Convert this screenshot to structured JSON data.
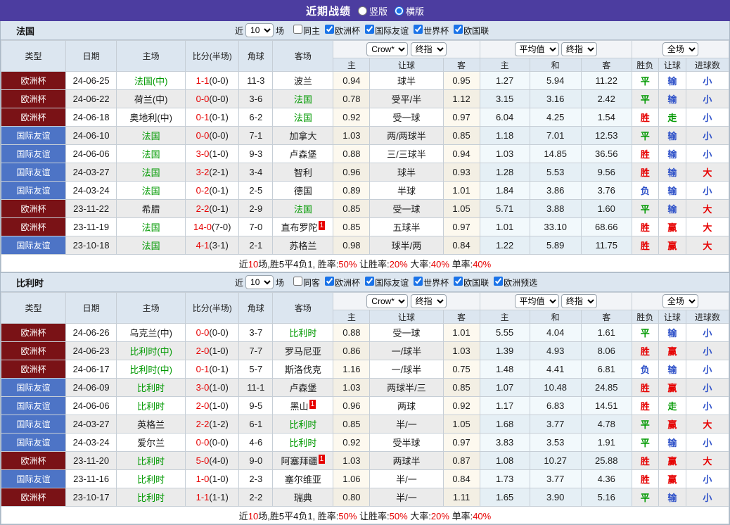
{
  "colors": {
    "titlebar_bg": "#4c3da0",
    "header_bg": "#dce6f0",
    "cup_badge": "#7a1216",
    "friendly_badge": "#4d74c6",
    "focus_team": "#009900",
    "score_red": "#e60000",
    "lose_blue": "#2d50c8",
    "stripe_bg": "#ebebeb"
  },
  "titlebar": {
    "title": "近期战绩",
    "options": [
      {
        "label": "竖版",
        "checked": false
      },
      {
        "label": "横版",
        "checked": true
      }
    ]
  },
  "table_header": {
    "static": [
      "类型",
      "日期",
      "主场",
      "比分(半场)",
      "角球",
      "客场"
    ],
    "group1": {
      "selects": [
        "Crow*",
        "终指"
      ],
      "cols": [
        "主",
        "让球",
        "客"
      ]
    },
    "group2": {
      "selects": [
        "平均值",
        "终指"
      ],
      "cols": [
        "主",
        "和",
        "客"
      ]
    },
    "group3": {
      "selects": [
        "全场"
      ],
      "cols": [
        "胜负",
        "让球",
        "进球数"
      ]
    }
  },
  "sections": [
    {
      "team": "法国",
      "filter": {
        "near_label": "近",
        "count": "10",
        "matches_label": "场",
        "same_label": "同主",
        "same_checked": false,
        "leagues": [
          "欧洲杯",
          "国际友谊",
          "世界杯",
          "欧国联"
        ]
      },
      "rows": [
        {
          "league": "欧洲杯",
          "league_type": "cup",
          "date": "24-06-25",
          "home": "法国(中)",
          "home_focus": true,
          "score": "1-1",
          "half": "(0-0)",
          "corners": "11-3",
          "away": "波兰",
          "away_focus": false,
          "away_sup": "",
          "odds_home": "0.94",
          "handicap": "球半",
          "odds_away": "0.95",
          "avg_home": "1.27",
          "avg_draw": "5.94",
          "avg_away": "11.22",
          "res_wdl": "平",
          "res_wdl_c": "green",
          "res_hc": "输",
          "res_hc_c": "blue",
          "res_goal": "小",
          "res_goal_c": "blue"
        },
        {
          "league": "欧洲杯",
          "league_type": "cup",
          "date": "24-06-22",
          "home": "荷兰(中)",
          "home_focus": false,
          "score": "0-0",
          "half": "(0-0)",
          "corners": "3-6",
          "away": "法国",
          "away_focus": true,
          "away_sup": "",
          "odds_home": "0.78",
          "handicap": "受平/半",
          "odds_away": "1.12",
          "avg_home": "3.15",
          "avg_draw": "3.16",
          "avg_away": "2.42",
          "res_wdl": "平",
          "res_wdl_c": "green",
          "res_hc": "输",
          "res_hc_c": "blue",
          "res_goal": "小",
          "res_goal_c": "blue"
        },
        {
          "league": "欧洲杯",
          "league_type": "cup",
          "date": "24-06-18",
          "home": "奥地利(中)",
          "home_focus": false,
          "score": "0-1",
          "half": "(0-1)",
          "corners": "6-2",
          "away": "法国",
          "away_focus": true,
          "away_sup": "",
          "odds_home": "0.92",
          "handicap": "受一球",
          "odds_away": "0.97",
          "avg_home": "6.04",
          "avg_draw": "4.25",
          "avg_away": "1.54",
          "res_wdl": "胜",
          "res_wdl_c": "red",
          "res_hc": "走",
          "res_hc_c": "green",
          "res_goal": "小",
          "res_goal_c": "blue"
        },
        {
          "league": "国际友谊",
          "league_type": "friendly",
          "date": "24-06-10",
          "home": "法国",
          "home_focus": true,
          "score": "0-0",
          "half": "(0-0)",
          "corners": "7-1",
          "away": "加拿大",
          "away_focus": false,
          "away_sup": "",
          "odds_home": "1.03",
          "handicap": "两/两球半",
          "odds_away": "0.85",
          "avg_home": "1.18",
          "avg_draw": "7.01",
          "avg_away": "12.53",
          "res_wdl": "平",
          "res_wdl_c": "green",
          "res_hc": "输",
          "res_hc_c": "blue",
          "res_goal": "小",
          "res_goal_c": "blue"
        },
        {
          "league": "国际友谊",
          "league_type": "friendly",
          "date": "24-06-06",
          "home": "法国",
          "home_focus": true,
          "score": "3-0",
          "half": "(1-0)",
          "corners": "9-3",
          "away": "卢森堡",
          "away_focus": false,
          "away_sup": "",
          "odds_home": "0.88",
          "handicap": "三/三球半",
          "odds_away": "0.94",
          "avg_home": "1.03",
          "avg_draw": "14.85",
          "avg_away": "36.56",
          "res_wdl": "胜",
          "res_wdl_c": "red",
          "res_hc": "输",
          "res_hc_c": "blue",
          "res_goal": "小",
          "res_goal_c": "blue"
        },
        {
          "league": "国际友谊",
          "league_type": "friendly",
          "date": "24-03-27",
          "home": "法国",
          "home_focus": true,
          "score": "3-2",
          "half": "(2-1)",
          "corners": "3-4",
          "away": "智利",
          "away_focus": false,
          "away_sup": "",
          "odds_home": "0.96",
          "handicap": "球半",
          "odds_away": "0.93",
          "avg_home": "1.28",
          "avg_draw": "5.53",
          "avg_away": "9.56",
          "res_wdl": "胜",
          "res_wdl_c": "red",
          "res_hc": "输",
          "res_hc_c": "blue",
          "res_goal": "大",
          "res_goal_c": "red"
        },
        {
          "league": "国际友谊",
          "league_type": "friendly",
          "date": "24-03-24",
          "home": "法国",
          "home_focus": true,
          "score": "0-2",
          "half": "(0-1)",
          "corners": "2-5",
          "away": "德国",
          "away_focus": false,
          "away_sup": "",
          "odds_home": "0.89",
          "handicap": "半球",
          "odds_away": "1.01",
          "avg_home": "1.84",
          "avg_draw": "3.86",
          "avg_away": "3.76",
          "res_wdl": "负",
          "res_wdl_c": "blue",
          "res_hc": "输",
          "res_hc_c": "blue",
          "res_goal": "小",
          "res_goal_c": "blue"
        },
        {
          "league": "欧洲杯",
          "league_type": "cup",
          "date": "23-11-22",
          "home": "希腊",
          "home_focus": false,
          "score": "2-2",
          "half": "(0-1)",
          "corners": "2-9",
          "away": "法国",
          "away_focus": true,
          "away_sup": "",
          "odds_home": "0.85",
          "handicap": "受一球",
          "odds_away": "1.05",
          "avg_home": "5.71",
          "avg_draw": "3.88",
          "avg_away": "1.60",
          "res_wdl": "平",
          "res_wdl_c": "green",
          "res_hc": "输",
          "res_hc_c": "blue",
          "res_goal": "大",
          "res_goal_c": "red"
        },
        {
          "league": "欧洲杯",
          "league_type": "cup",
          "date": "23-11-19",
          "home": "法国",
          "home_focus": true,
          "score": "14-0",
          "half": "(7-0)",
          "corners": "7-0",
          "away": "直布罗陀",
          "away_focus": false,
          "away_sup": "1",
          "odds_home": "0.85",
          "handicap": "五球半",
          "odds_away": "0.97",
          "avg_home": "1.01",
          "avg_draw": "33.10",
          "avg_away": "68.66",
          "res_wdl": "胜",
          "res_wdl_c": "red",
          "res_hc": "赢",
          "res_hc_c": "red",
          "res_goal": "大",
          "res_goal_c": "red"
        },
        {
          "league": "国际友谊",
          "league_type": "friendly",
          "date": "23-10-18",
          "home": "法国",
          "home_focus": true,
          "score": "4-1",
          "half": "(3-1)",
          "corners": "2-1",
          "away": "苏格兰",
          "away_focus": false,
          "away_sup": "",
          "odds_home": "0.98",
          "handicap": "球半/两",
          "odds_away": "0.84",
          "avg_home": "1.22",
          "avg_draw": "5.89",
          "avg_away": "11.75",
          "res_wdl": "胜",
          "res_wdl_c": "red",
          "res_hc": "赢",
          "res_hc_c": "red",
          "res_goal": "大",
          "res_goal_c": "red"
        }
      ],
      "summary": [
        {
          "t": "近",
          "c": "k"
        },
        {
          "t": "10",
          "c": "r"
        },
        {
          "t": "场,胜5平4负1, 胜率:",
          "c": "k"
        },
        {
          "t": "50%",
          "c": "r"
        },
        {
          "t": " 让胜率:",
          "c": "k"
        },
        {
          "t": "20%",
          "c": "r"
        },
        {
          "t": " 大率:",
          "c": "k"
        },
        {
          "t": "40%",
          "c": "r"
        },
        {
          "t": " 单率:",
          "c": "k"
        },
        {
          "t": "40%",
          "c": "r"
        }
      ]
    },
    {
      "team": "比利时",
      "filter": {
        "near_label": "近",
        "count": "10",
        "matches_label": "场",
        "same_label": "同客",
        "same_checked": false,
        "leagues": [
          "欧洲杯",
          "国际友谊",
          "世界杯",
          "欧国联",
          "欧洲预选"
        ]
      },
      "rows": [
        {
          "league": "欧洲杯",
          "league_type": "cup",
          "date": "24-06-26",
          "home": "乌克兰(中)",
          "home_focus": false,
          "score": "0-0",
          "half": "(0-0)",
          "corners": "3-7",
          "away": "比利时",
          "away_focus": true,
          "away_sup": "",
          "odds_home": "0.88",
          "handicap": "受一球",
          "odds_away": "1.01",
          "avg_home": "5.55",
          "avg_draw": "4.04",
          "avg_away": "1.61",
          "res_wdl": "平",
          "res_wdl_c": "green",
          "res_hc": "输",
          "res_hc_c": "blue",
          "res_goal": "小",
          "res_goal_c": "blue"
        },
        {
          "league": "欧洲杯",
          "league_type": "cup",
          "date": "24-06-23",
          "home": "比利时(中)",
          "home_focus": true,
          "score": "2-0",
          "half": "(1-0)",
          "corners": "7-7",
          "away": "罗马尼亚",
          "away_focus": false,
          "away_sup": "",
          "odds_home": "0.86",
          "handicap": "一/球半",
          "odds_away": "1.03",
          "avg_home": "1.39",
          "avg_draw": "4.93",
          "avg_away": "8.06",
          "res_wdl": "胜",
          "res_wdl_c": "red",
          "res_hc": "赢",
          "res_hc_c": "red",
          "res_goal": "小",
          "res_goal_c": "blue"
        },
        {
          "league": "欧洲杯",
          "league_type": "cup",
          "date": "24-06-17",
          "home": "比利时(中)",
          "home_focus": true,
          "score": "0-1",
          "half": "(0-1)",
          "corners": "5-7",
          "away": "斯洛伐克",
          "away_focus": false,
          "away_sup": "",
          "odds_home": "1.16",
          "handicap": "一/球半",
          "odds_away": "0.75",
          "avg_home": "1.48",
          "avg_draw": "4.41",
          "avg_away": "6.81",
          "res_wdl": "负",
          "res_wdl_c": "blue",
          "res_hc": "输",
          "res_hc_c": "blue",
          "res_goal": "小",
          "res_goal_c": "blue"
        },
        {
          "league": "国际友谊",
          "league_type": "friendly",
          "date": "24-06-09",
          "home": "比利时",
          "home_focus": true,
          "score": "3-0",
          "half": "(1-0)",
          "corners": "11-1",
          "away": "卢森堡",
          "away_focus": false,
          "away_sup": "",
          "odds_home": "1.03",
          "handicap": "两球半/三",
          "odds_away": "0.85",
          "avg_home": "1.07",
          "avg_draw": "10.48",
          "avg_away": "24.85",
          "res_wdl": "胜",
          "res_wdl_c": "red",
          "res_hc": "赢",
          "res_hc_c": "red",
          "res_goal": "小",
          "res_goal_c": "blue"
        },
        {
          "league": "国际友谊",
          "league_type": "friendly",
          "date": "24-06-06",
          "home": "比利时",
          "home_focus": true,
          "score": "2-0",
          "half": "(1-0)",
          "corners": "9-5",
          "away": "黑山",
          "away_focus": false,
          "away_sup": "1",
          "odds_home": "0.96",
          "handicap": "两球",
          "odds_away": "0.92",
          "avg_home": "1.17",
          "avg_draw": "6.83",
          "avg_away": "14.51",
          "res_wdl": "胜",
          "res_wdl_c": "red",
          "res_hc": "走",
          "res_hc_c": "green",
          "res_goal": "小",
          "res_goal_c": "blue"
        },
        {
          "league": "国际友谊",
          "league_type": "friendly",
          "date": "24-03-27",
          "home": "英格兰",
          "home_focus": false,
          "score": "2-2",
          "half": "(1-2)",
          "corners": "6-1",
          "away": "比利时",
          "away_focus": true,
          "away_sup": "",
          "odds_home": "0.85",
          "handicap": "半/一",
          "odds_away": "1.05",
          "avg_home": "1.68",
          "avg_draw": "3.77",
          "avg_away": "4.78",
          "res_wdl": "平",
          "res_wdl_c": "green",
          "res_hc": "赢",
          "res_hc_c": "red",
          "res_goal": "大",
          "res_goal_c": "red"
        },
        {
          "league": "国际友谊",
          "league_type": "friendly",
          "date": "24-03-24",
          "home": "爱尔兰",
          "home_focus": false,
          "score": "0-0",
          "half": "(0-0)",
          "corners": "4-6",
          "away": "比利时",
          "away_focus": true,
          "away_sup": "",
          "odds_home": "0.92",
          "handicap": "受半球",
          "odds_away": "0.97",
          "avg_home": "3.83",
          "avg_draw": "3.53",
          "avg_away": "1.91",
          "res_wdl": "平",
          "res_wdl_c": "green",
          "res_hc": "输",
          "res_hc_c": "blue",
          "res_goal": "小",
          "res_goal_c": "blue"
        },
        {
          "league": "欧洲杯",
          "league_type": "cup",
          "date": "23-11-20",
          "home": "比利时",
          "home_focus": true,
          "score": "5-0",
          "half": "(4-0)",
          "corners": "9-0",
          "away": "阿塞拜疆",
          "away_focus": false,
          "away_sup": "1",
          "odds_home": "1.03",
          "handicap": "两球半",
          "odds_away": "0.87",
          "avg_home": "1.08",
          "avg_draw": "10.27",
          "avg_away": "25.88",
          "res_wdl": "胜",
          "res_wdl_c": "red",
          "res_hc": "赢",
          "res_hc_c": "red",
          "res_goal": "大",
          "res_goal_c": "red"
        },
        {
          "league": "国际友谊",
          "league_type": "friendly",
          "date": "23-11-16",
          "home": "比利时",
          "home_focus": true,
          "score": "1-0",
          "half": "(1-0)",
          "corners": "2-3",
          "away": "塞尔维亚",
          "away_focus": false,
          "away_sup": "",
          "odds_home": "1.06",
          "handicap": "半/一",
          "odds_away": "0.84",
          "avg_home": "1.73",
          "avg_draw": "3.77",
          "avg_away": "4.36",
          "res_wdl": "胜",
          "res_wdl_c": "red",
          "res_hc": "赢",
          "res_hc_c": "red",
          "res_goal": "小",
          "res_goal_c": "blue"
        },
        {
          "league": "欧洲杯",
          "league_type": "cup",
          "date": "23-10-17",
          "home": "比利时",
          "home_focus": true,
          "score": "1-1",
          "half": "(1-1)",
          "corners": "2-2",
          "away": "瑞典",
          "away_focus": false,
          "away_sup": "",
          "odds_home": "0.80",
          "handicap": "半/一",
          "odds_away": "1.11",
          "avg_home": "1.65",
          "avg_draw": "3.90",
          "avg_away": "5.16",
          "res_wdl": "平",
          "res_wdl_c": "green",
          "res_hc": "输",
          "res_hc_c": "blue",
          "res_goal": "小",
          "res_goal_c": "blue"
        }
      ],
      "summary": [
        {
          "t": "近",
          "c": "k"
        },
        {
          "t": "10",
          "c": "r"
        },
        {
          "t": "场,胜5平4负1, 胜率:",
          "c": "k"
        },
        {
          "t": "50%",
          "c": "r"
        },
        {
          "t": " 让胜率:",
          "c": "k"
        },
        {
          "t": "50%",
          "c": "r"
        },
        {
          "t": " 大率:",
          "c": "k"
        },
        {
          "t": "20%",
          "c": "r"
        },
        {
          "t": " 单率:",
          "c": "k"
        },
        {
          "t": "40%",
          "c": "r"
        }
      ]
    }
  ]
}
